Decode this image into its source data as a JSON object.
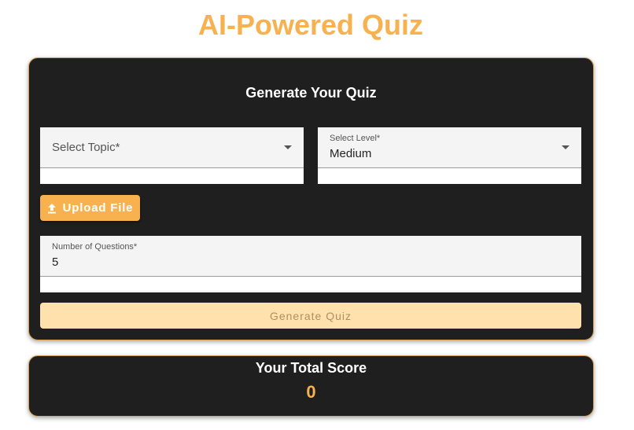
{
  "page": {
    "title": "AI-Powered Quiz"
  },
  "quiz_form": {
    "heading": "Generate Your Quiz",
    "topic_select": {
      "placeholder": "Select Topic*"
    },
    "level_select": {
      "label": "Select Level*",
      "value": "Medium"
    },
    "upload_button_label": "Upload File",
    "questions_input": {
      "label": "Number of Questions*",
      "value": "5"
    },
    "generate_button_label": "Generate Quiz"
  },
  "score": {
    "heading": "Your Total Score",
    "value": "0"
  },
  "colors": {
    "accent": "#f7b24f",
    "card_background": "#1f1f1f",
    "disabled_button": "#ffe1ad"
  },
  "icons": {
    "upload": "upload-icon",
    "dropdown": "chevron-down-icon"
  }
}
